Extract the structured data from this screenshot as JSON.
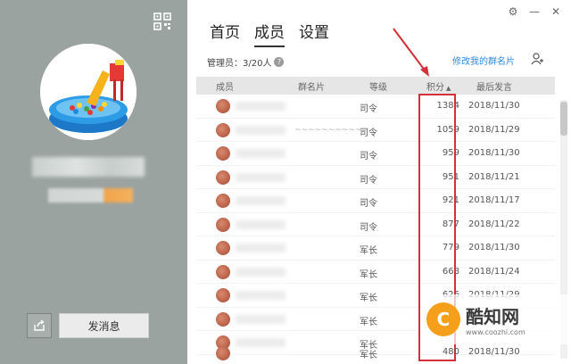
{
  "left_panel": {
    "send_message_label": "发消息"
  },
  "window": {
    "icons": [
      "settings-icon",
      "minimize-icon",
      "close-icon"
    ]
  },
  "tabs": [
    {
      "label": "首页",
      "active": false
    },
    {
      "label": "成员",
      "active": true
    },
    {
      "label": "设置",
      "active": false
    }
  ],
  "admin_info": "管理员：3/20人",
  "edit_card_link": "修改我的群名片",
  "table": {
    "headers": {
      "member": "成员",
      "group_card": "群名片",
      "level": "等级",
      "points": "积分",
      "last_speak": "最后发言"
    },
    "rows": [
      {
        "card_suffix": "",
        "level": "司令",
        "points": "1384",
        "date": "2018/11/30"
      },
      {
        "card_suffix": "~~~~~~~~~~~-~~~~~~~~~~~~~~~~~~~~~~~~~~~~~-@...",
        "level": "司令",
        "points": "1059",
        "date": "2018/11/29"
      },
      {
        "card_suffix": "",
        "level": "司令",
        "points": "959",
        "date": "2018/11/30"
      },
      {
        "card_suffix": "",
        "level": "司令",
        "points": "951",
        "date": "2018/11/21"
      },
      {
        "card_suffix": "",
        "level": "司令",
        "points": "921",
        "date": "2018/11/17"
      },
      {
        "card_suffix": "",
        "level": "司令",
        "points": "877",
        "date": "2018/11/22"
      },
      {
        "card_suffix": "",
        "level": "军长",
        "points": "779",
        "date": "2018/11/30"
      },
      {
        "card_suffix": "",
        "level": "军长",
        "points": "668",
        "date": "2018/11/24"
      },
      {
        "card_suffix": "",
        "level": "军长",
        "points": "626",
        "date": "2018/11/29"
      },
      {
        "card_suffix": "",
        "level": "军长",
        "points": "",
        "date": ""
      },
      {
        "card_suffix": "",
        "level": "军长",
        "points": "",
        "date": ""
      },
      {
        "card_suffix": "",
        "level": "军长",
        "points": "480",
        "date": "2018/11/30"
      }
    ]
  },
  "watermark": {
    "name": "酷知网",
    "url": "www.coozhi.com"
  },
  "colors": {
    "left_panel_bg": "#9ba3a1",
    "accent_link": "#2a8ae4",
    "highlight_box": "#d2313a"
  }
}
